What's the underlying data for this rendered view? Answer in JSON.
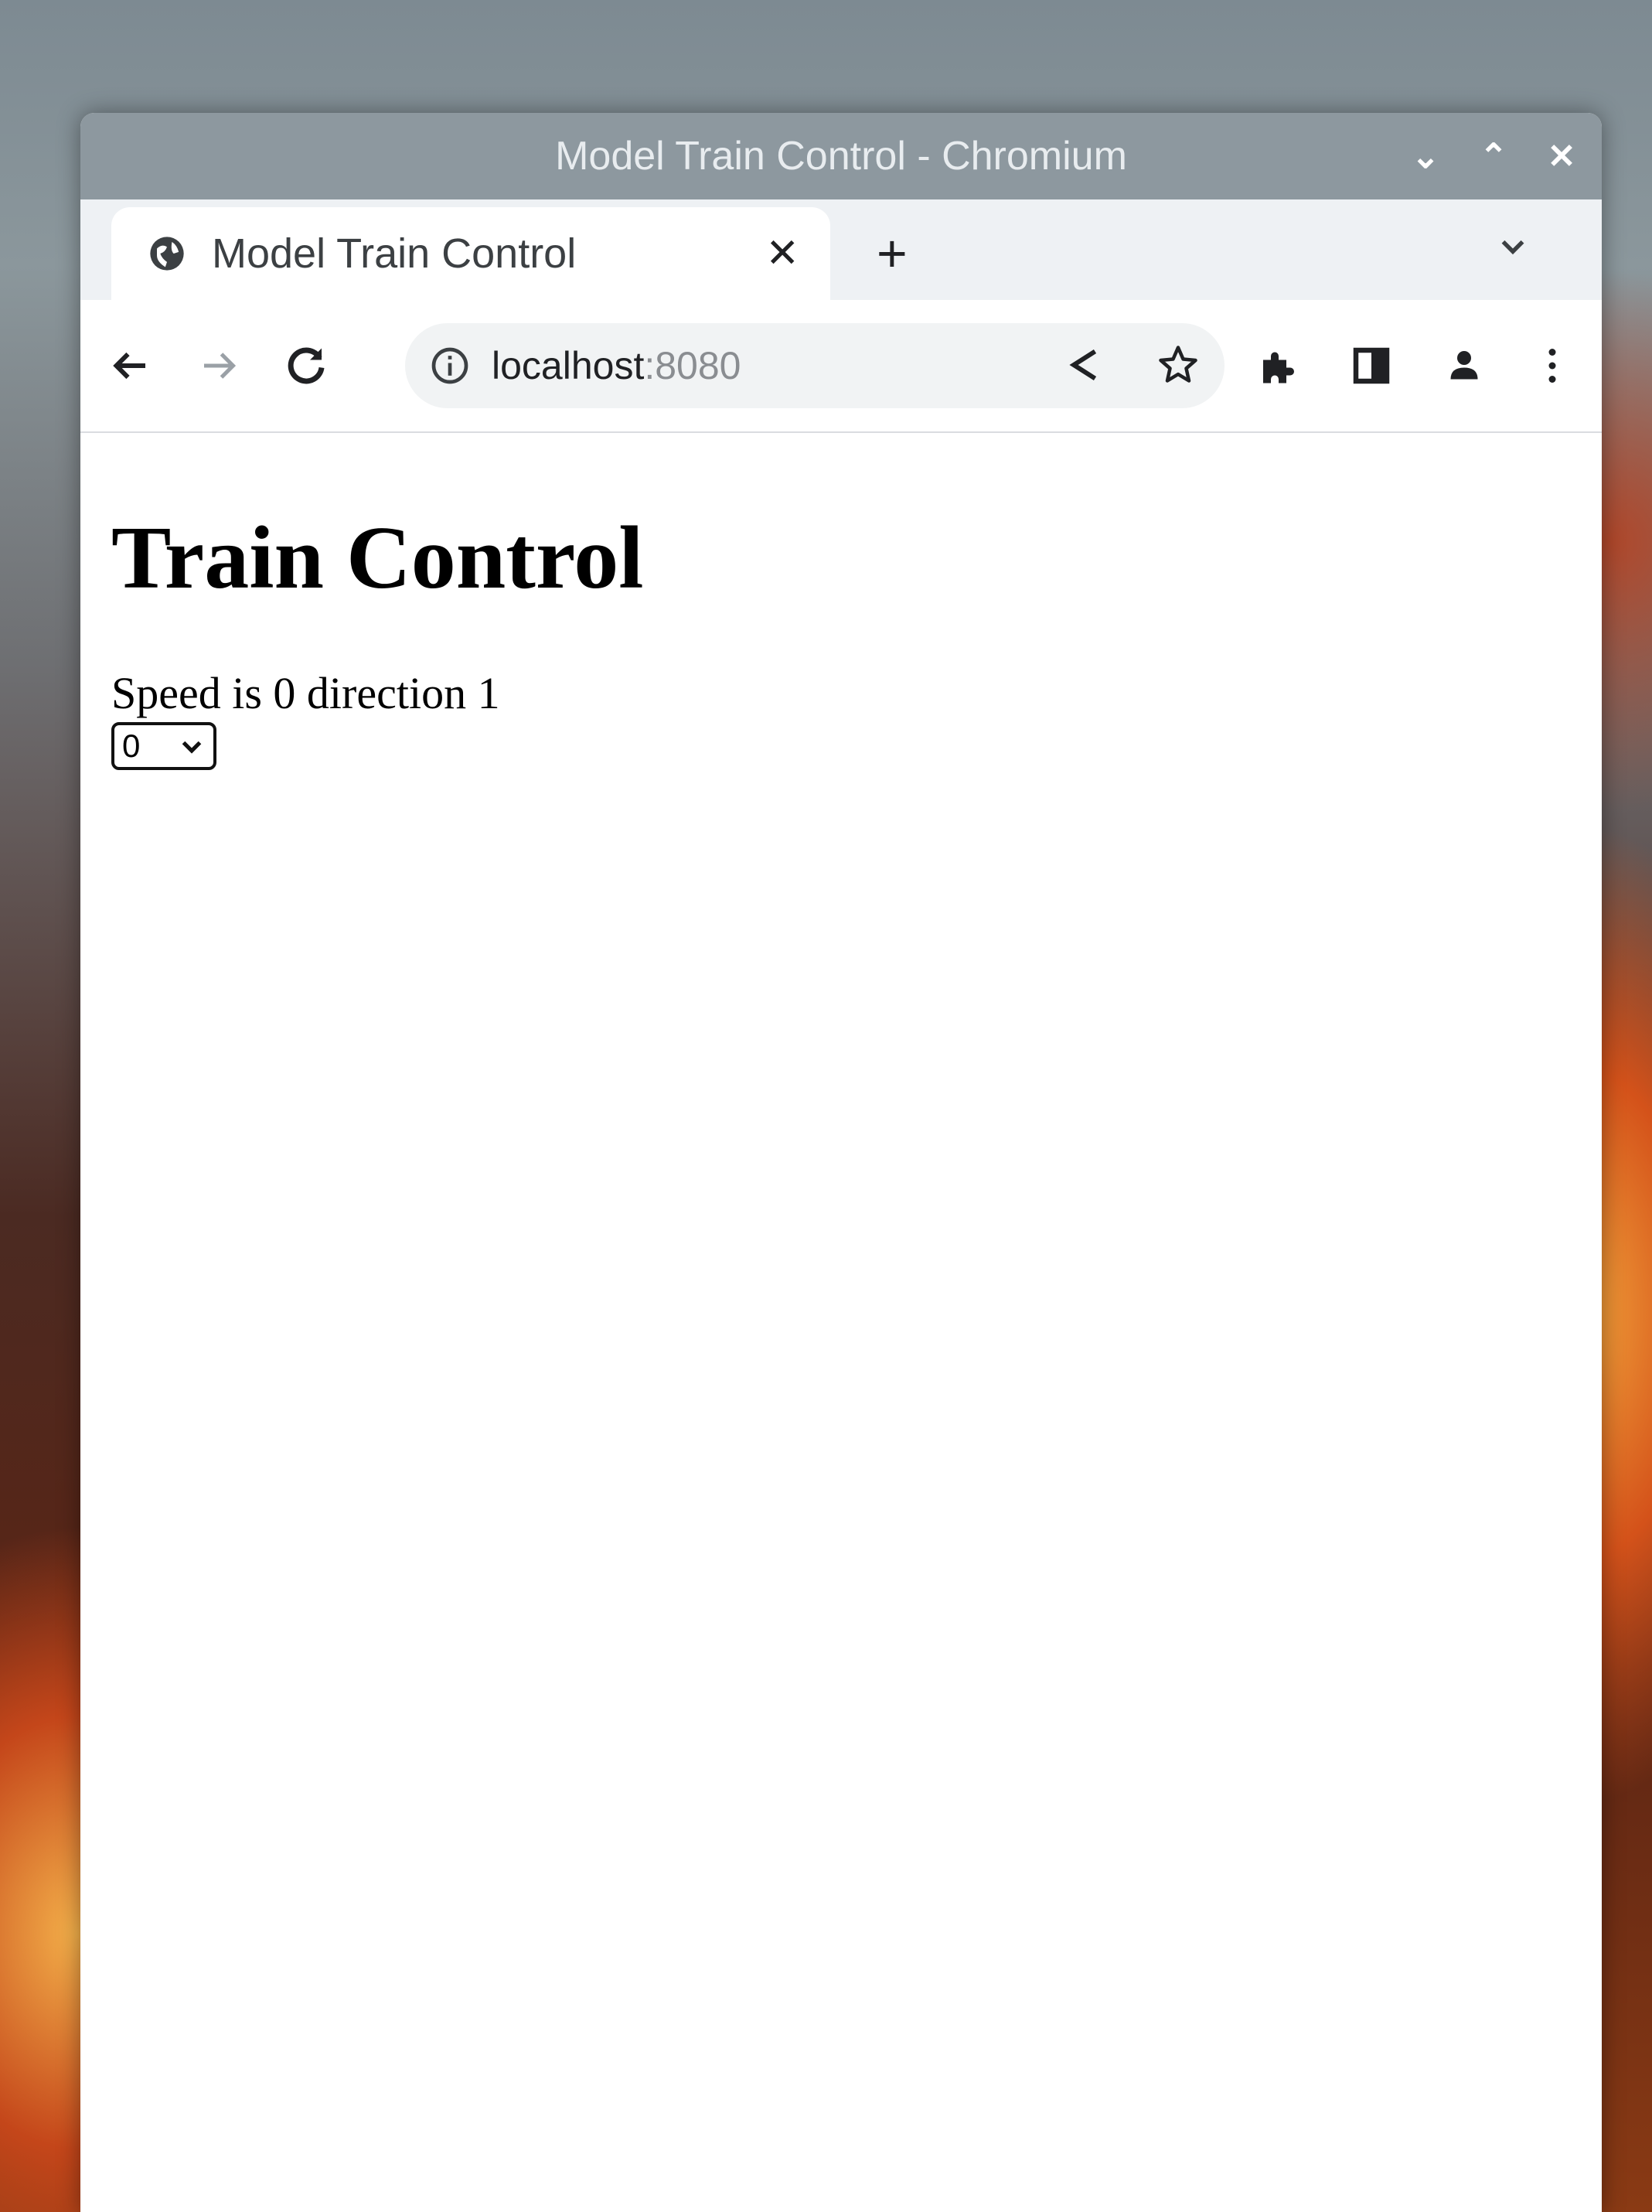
{
  "window": {
    "title": "Model Train Control - Chromium",
    "controls": {
      "minimize": "⌄",
      "maximize": "⌃",
      "close": "✕"
    }
  },
  "tabs": [
    {
      "title": "Model Train Control",
      "icon": "globe-icon",
      "close": "✕",
      "active": true
    }
  ],
  "tabstrip": {
    "new_tab": "+"
  },
  "omnibox": {
    "host": "localhost",
    "port": ":8080"
  },
  "page": {
    "heading": "Train Control",
    "status_text": "Speed is 0 direction 1",
    "speed_select": {
      "selected": "0"
    }
  }
}
